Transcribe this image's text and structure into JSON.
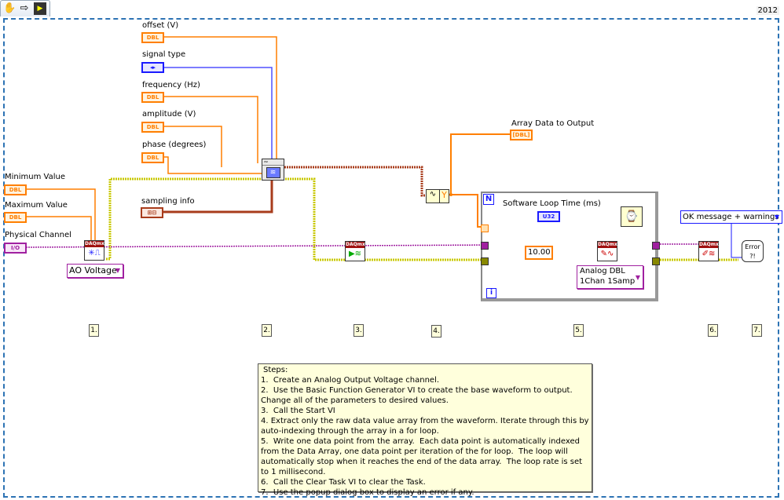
{
  "toolbar": {
    "icons": [
      "hand-icon",
      "arrow-right-icon",
      "vi-icon"
    ]
  },
  "version_label": "2012",
  "controls": {
    "offset": {
      "label": "offset (V)",
      "type": "DBL"
    },
    "signal_type": {
      "label": "signal type",
      "type": "◂▸"
    },
    "frequency": {
      "label": "frequency (Hz)",
      "type": "DBL"
    },
    "amplitude": {
      "label": "amplitude (V)",
      "type": "DBL"
    },
    "phase": {
      "label": "phase (degrees)",
      "type": "DBL"
    },
    "sampling_info": {
      "label": "sampling info",
      "type": "⊞⊟"
    },
    "minimum_value": {
      "label": "Minimum Value",
      "type": "DBL"
    },
    "maximum_value": {
      "label": "Maximum Value",
      "type": "DBL"
    },
    "physical_channel": {
      "label": "Physical Channel",
      "type": "I/O"
    }
  },
  "indicators": {
    "array_data": {
      "label": "Array Data to Output",
      "type": "[DBL]"
    }
  },
  "vis": {
    "create_channel": {
      "header": "DAQmx",
      "ring": "AO Voltage"
    },
    "function_generator": {
      "header": ""
    },
    "start_task": {
      "header": "DAQmx"
    },
    "get_waveform": {
      "left": "∿",
      "right": "Y"
    },
    "write": {
      "header": "DAQmx",
      "ring_line1": "Analog DBL",
      "ring_line2": "1Chan 1Samp"
    },
    "clear_task": {
      "header": "DAQmx"
    },
    "error_dialog": {
      "glyph": "Error ?!",
      "ring": "OK message + warnings"
    }
  },
  "loop": {
    "count_terminal": "N",
    "iteration_terminal": "i",
    "loop_time_label": "Software Loop Time (ms)",
    "loop_time_type": "U32",
    "timeout_constant": "10.00"
  },
  "steps": [
    "1.",
    "2.",
    "3.",
    "4.",
    "5.",
    "6.",
    "7."
  ],
  "notes": {
    "title": "Steps:",
    "lines": [
      "1.  Create an Analog Output Voltage channel.",
      "2.  Use the Basic Function Generator VI to create the base waveform to output.  Change all of the parameters to desired values.",
      "3.  Call the Start VI",
      "4. Extract only the raw data value array from the waveform. Iterate through this by auto-indexing through the array in a for loop.",
      "5.  Write one data point from the array.  Each data point is automatically indexed from the Data Array, one data point per iteration of the for loop.  The loop will automatically stop when it reaches the end of the data array.  The loop rate is set to 1 millisecond.",
      "6.  Call the Clear Task VI to clear the Task.",
      "7.  Use the popup dialog box to display an error if any."
    ]
  },
  "colors": {
    "dbl": "#ff7f00",
    "enum": "#1a1aff",
    "task": "#a020a0",
    "error": "#c8c800",
    "cluster": "#a83c1c",
    "frame": "#2d73b4"
  }
}
